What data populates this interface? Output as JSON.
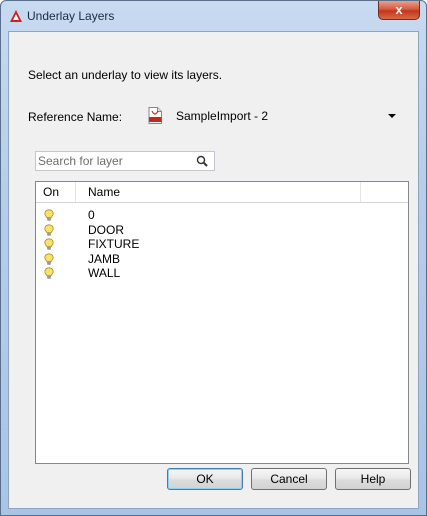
{
  "window": {
    "title": "Underlay Layers",
    "close_glyph": "x",
    "app_icon": "autocad-a-icon"
  },
  "dialog": {
    "instruction": "Select an underlay to view its layers.",
    "reference_label": "Reference Name:",
    "reference_value": "SampleImport - 2",
    "reference_icon": "pdf-file-icon",
    "search_placeholder": "Search for layer"
  },
  "list": {
    "columns": [
      "On",
      "Name"
    ],
    "rows": [
      {
        "on": true,
        "name": "0"
      },
      {
        "on": true,
        "name": "DOOR"
      },
      {
        "on": true,
        "name": "FIXTURE"
      },
      {
        "on": true,
        "name": "JAMB"
      },
      {
        "on": true,
        "name": "WALL"
      }
    ]
  },
  "buttons": {
    "ok": "OK",
    "cancel": "Cancel",
    "help": "Help"
  },
  "colors": {
    "bulb_on": "#f7e36a",
    "close_red": "#c2371b",
    "title_blue": "#b5cde8"
  }
}
